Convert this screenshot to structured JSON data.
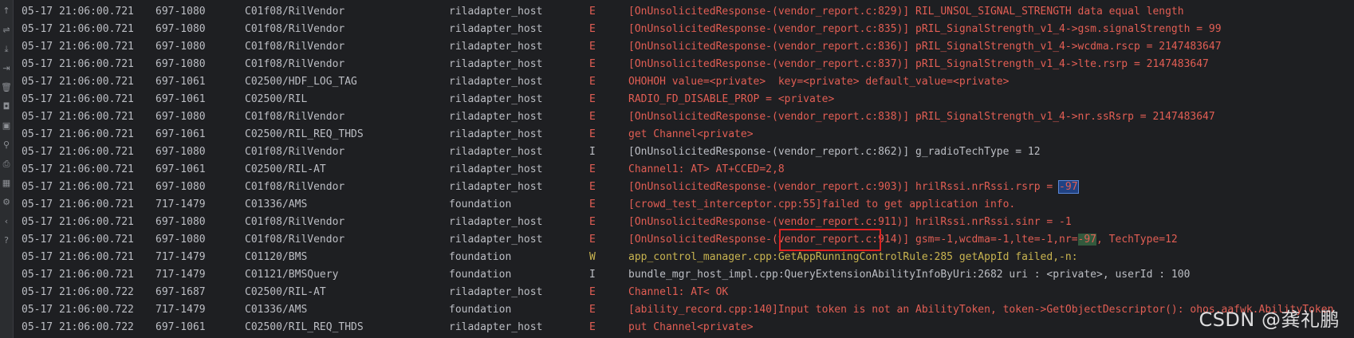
{
  "gutter_icons": [
    "scroll-up-icon",
    "soft-wrap-icon",
    "scroll-to-end-icon",
    "import-icon",
    "clear-icon",
    "camera-icon",
    "video-icon",
    "filter-icon",
    "print-icon",
    "layout-icon",
    "settings-icon",
    "back-icon",
    "help-icon"
  ],
  "rows": [
    {
      "time": "05-17 21:06:00.721",
      "pid": "697-1080",
      "tag": "C01f08/RilVendor",
      "pkg": "riladapter_host",
      "level": "E",
      "msg": "[OnUnsolicitedResponse-(vendor_report.c:829)] RIL_UNSOL_SIGNAL_STRENGTH data equal length"
    },
    {
      "time": "05-17 21:06:00.721",
      "pid": "697-1080",
      "tag": "C01f08/RilVendor",
      "pkg": "riladapter_host",
      "level": "E",
      "msg": "[OnUnsolicitedResponse-(vendor_report.c:835)] pRIL_SignalStrength_v1_4->gsm.signalStrength = 99"
    },
    {
      "time": "05-17 21:06:00.721",
      "pid": "697-1080",
      "tag": "C01f08/RilVendor",
      "pkg": "riladapter_host",
      "level": "E",
      "msg": "[OnUnsolicitedResponse-(vendor_report.c:836)] pRIL_SignalStrength_v1_4->wcdma.rscp = 2147483647"
    },
    {
      "time": "05-17 21:06:00.721",
      "pid": "697-1080",
      "tag": "C01f08/RilVendor",
      "pkg": "riladapter_host",
      "level": "E",
      "msg": "[OnUnsolicitedResponse-(vendor_report.c:837)] pRIL_SignalStrength_v1_4->lte.rsrp = 2147483647"
    },
    {
      "time": "05-17 21:06:00.721",
      "pid": "697-1061",
      "tag": "C02500/HDF_LOG_TAG",
      "pkg": "riladapter_host",
      "level": "E",
      "msg": "OHOHOH value=<private>  key=<private> default_value=<private>"
    },
    {
      "time": "05-17 21:06:00.721",
      "pid": "697-1061",
      "tag": "C02500/RIL",
      "pkg": "riladapter_host",
      "level": "E",
      "msg": "RADIO_FD_DISABLE_PROP = <private>"
    },
    {
      "time": "05-17 21:06:00.721",
      "pid": "697-1080",
      "tag": "C01f08/RilVendor",
      "pkg": "riladapter_host",
      "level": "E",
      "msg": "[OnUnsolicitedResponse-(vendor_report.c:838)] pRIL_SignalStrength_v1_4->nr.ssRsrp = 2147483647"
    },
    {
      "time": "05-17 21:06:00.721",
      "pid": "697-1061",
      "tag": "C02500/RIL_REQ_THDS",
      "pkg": "riladapter_host",
      "level": "E",
      "msg": "get Channel<private>"
    },
    {
      "time": "05-17 21:06:00.721",
      "pid": "697-1080",
      "tag": "C01f08/RilVendor",
      "pkg": "riladapter_host",
      "level": "I",
      "msg": "[OnUnsolicitedResponse-(vendor_report.c:862)] g_radioTechType = 12"
    },
    {
      "time": "05-17 21:06:00.721",
      "pid": "697-1061",
      "tag": "C02500/RIL-AT",
      "pkg": "riladapter_host",
      "level": "E",
      "msg": "Channel1: AT> AT+CCED=2,8"
    },
    {
      "time": "05-17 21:06:00.721",
      "pid": "697-1080",
      "tag": "C01f08/RilVendor",
      "pkg": "riladapter_host",
      "level": "E",
      "msg": "[OnUnsolicitedResponse-(vendor_report.c:903)] hrilRssi.nrRssi.rsrp = ",
      "hl": "-97",
      "hl_style": "blue",
      "msg_after": ""
    },
    {
      "time": "05-17 21:06:00.721",
      "pid": "717-1479",
      "tag": "C01336/AMS",
      "pkg": "foundation",
      "level": "E",
      "msg": "[crowd_test_interceptor.cpp:55]failed to get application info."
    },
    {
      "time": "05-17 21:06:00.721",
      "pid": "697-1080",
      "tag": "C01f08/RilVendor",
      "pkg": "riladapter_host",
      "level": "E",
      "msg": "[OnUnsolicitedResponse-(vendor_report.c:911)] hrilRssi.nrRssi.sinr = -1"
    },
    {
      "time": "05-17 21:06:00.721",
      "pid": "697-1080",
      "tag": "C01f08/RilVendor",
      "pkg": "riladapter_host",
      "level": "E",
      "msg": "[OnUnsolicitedResponse-(vendor_report.c:914)] gsm=-1,wcdma=-1,lte=-1,nr=",
      "hl": "-97",
      "hl_style": "green",
      "msg_after": ", TechType=12"
    },
    {
      "time": "05-17 21:06:00.721",
      "pid": "717-1479",
      "tag": "C01120/BMS",
      "pkg": "foundation",
      "level": "W",
      "msg": "app_control_manager.cpp:GetAppRunningControlRule:285 getAppId failed,-n:"
    },
    {
      "time": "05-17 21:06:00.721",
      "pid": "717-1479",
      "tag": "C01121/BMSQuery",
      "pkg": "foundation",
      "level": "I",
      "msg": "bundle_mgr_host_impl.cpp:QueryExtensionAbilityInfoByUri:2682 uri : <private>, userId : 100"
    },
    {
      "time": "05-17 21:06:00.722",
      "pid": "697-1687",
      "tag": "C02500/RIL-AT",
      "pkg": "riladapter_host",
      "level": "E",
      "msg": "Channel1: AT< OK"
    },
    {
      "time": "05-17 21:06:00.722",
      "pid": "717-1479",
      "tag": "C01336/AMS",
      "pkg": "foundation",
      "level": "E",
      "msg": "[ability_record.cpp:140]Input token is not an AbilityToken, token->GetObjectDescriptor(): ohos.aafwk.AbilityToken"
    },
    {
      "time": "05-17 21:06:00.722",
      "pid": "697-1061",
      "tag": "C02500/RIL_REQ_THDS",
      "pkg": "riladapter_host",
      "level": "E",
      "msg": "put Channel<private>"
    }
  ],
  "watermark": "CSDN @龚礼鹏",
  "colors": {
    "error": "#e25e54",
    "info": "#bcbec4",
    "warn": "#c9b450",
    "background": "#1e1f22",
    "annotation_box": "#e02020"
  }
}
